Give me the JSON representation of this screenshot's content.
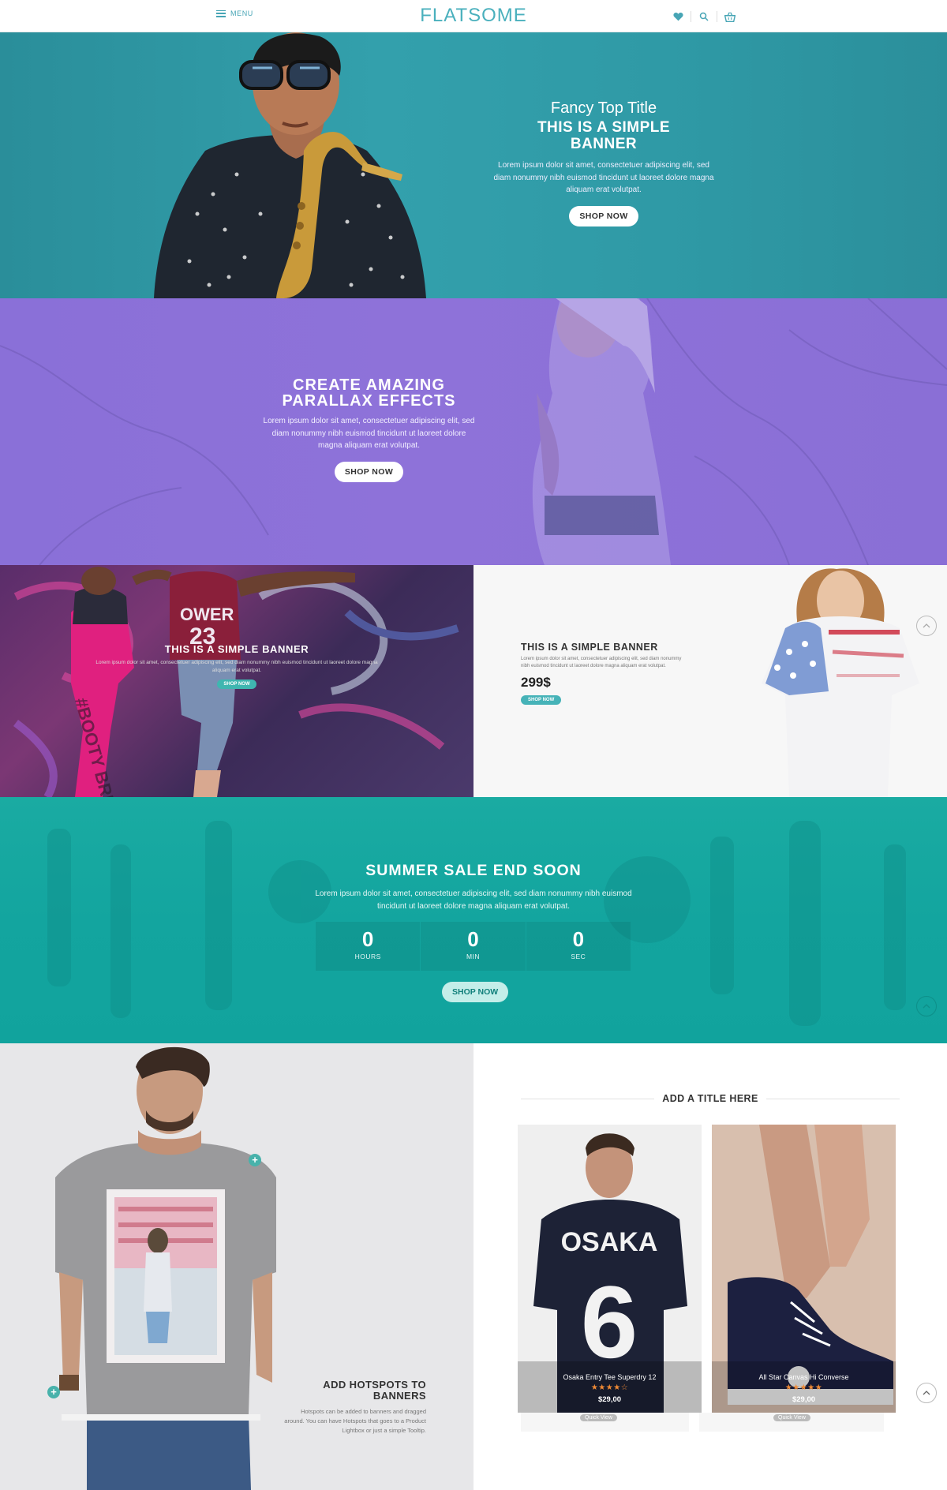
{
  "header": {
    "menu_label": "MENU",
    "logo": "FLATSOME"
  },
  "hero": {
    "top_title": "Fancy Top Title",
    "title_line1": "THIS IS A SIMPLE",
    "title_line2": "BANNER",
    "body": "Lorem ipsum dolor sit amet, consectetuer adipiscing elit, sed diam nonummy nibh euismod tincidunt ut laoreet dolore magna aliquam erat volutpat.",
    "button": "SHOP NOW"
  },
  "parallax": {
    "title_line1": "CREATE AMAZING",
    "title_line2": "PARALLAX EFFECTS",
    "body": "Lorem ipsum dolor sit amet, consectetuer adipiscing elit, sed diam nonummy nibh euismod tincidunt ut laoreet dolore magna aliquam erat volutpat.",
    "button": "SHOP NOW"
  },
  "banner_left": {
    "title": "THIS IS A SIMPLE BANNER",
    "body": "Lorem ipsum dolor sit amet, consectetuer adipiscing elit, sed diam nonummy nibh euismod tincidunt ut laoreet dolore magna aliquam erat volutpat.",
    "button": "SHOP NOW"
  },
  "banner_right": {
    "title": "THIS IS A SIMPLE BANNER",
    "body": "Lorem ipsum dolor sit amet, consectetuer adipiscing elit, sed diam nonummy nibh euismod tincidunt ut laoreet dolore magna aliquam erat volutpat.",
    "price": "299$",
    "button": "SHOP NOW"
  },
  "sale": {
    "title": "SUMMER SALE END SOON",
    "body": "Lorem ipsum dolor sit amet, consectetuer adipiscing elit, sed diam nonummy nibh euismod tincidunt ut laoreet dolore magna aliquam erat volutpat.",
    "countdown": [
      {
        "value": "0",
        "label": "HOURS"
      },
      {
        "value": "0",
        "label": "MIN"
      },
      {
        "value": "0",
        "label": "SEC"
      }
    ],
    "button": "SHOP NOW"
  },
  "hotspots": {
    "title_line1": "ADD HOTSPOTS TO",
    "title_line2": "BANNERS",
    "body": "Hotspots can be added to banners and dragged around. You can have Hotspots that goes to a Product Lightbox or just a simple Tooltip.",
    "dot_symbol": "+"
  },
  "products": {
    "section_title": "ADD A TITLE HERE",
    "items": [
      {
        "name": "Osaka Entry Tee Superdry 12",
        "stars": "★★★★☆",
        "price": "$29,00",
        "quick_view": "Quick View"
      },
      {
        "name": "All Star Canvas Hi Converse",
        "stars": "★★★★★",
        "price": "$29,00",
        "quick_view": "Quick View"
      }
    ]
  },
  "colors": {
    "brand": "#4ab0bd",
    "hero_bg": "#2f9aa6",
    "parallax_bg": "#8e72d9",
    "sale_bg": "#13a59f",
    "accent_teal": "#46b3b8",
    "star": "#f08a35"
  }
}
